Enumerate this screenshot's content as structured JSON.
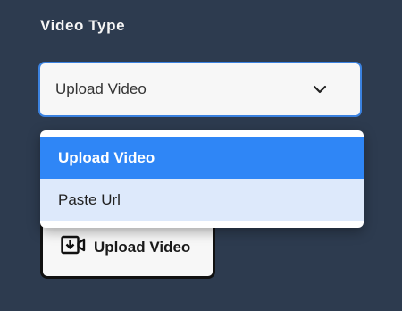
{
  "video_type": {
    "label": "Video Type",
    "selected_value": "Upload Video",
    "options": [
      {
        "label": "Upload Video",
        "state": "selected"
      },
      {
        "label": "Paste Url",
        "state": "hover"
      }
    ]
  },
  "upload_button": {
    "label": "Upload Video",
    "icon": "video-download-icon"
  },
  "colors": {
    "background": "#2d3b4f",
    "accent": "#2f86f6",
    "focus_border": "#3b82e0",
    "hover_option": "#dde9fb"
  }
}
